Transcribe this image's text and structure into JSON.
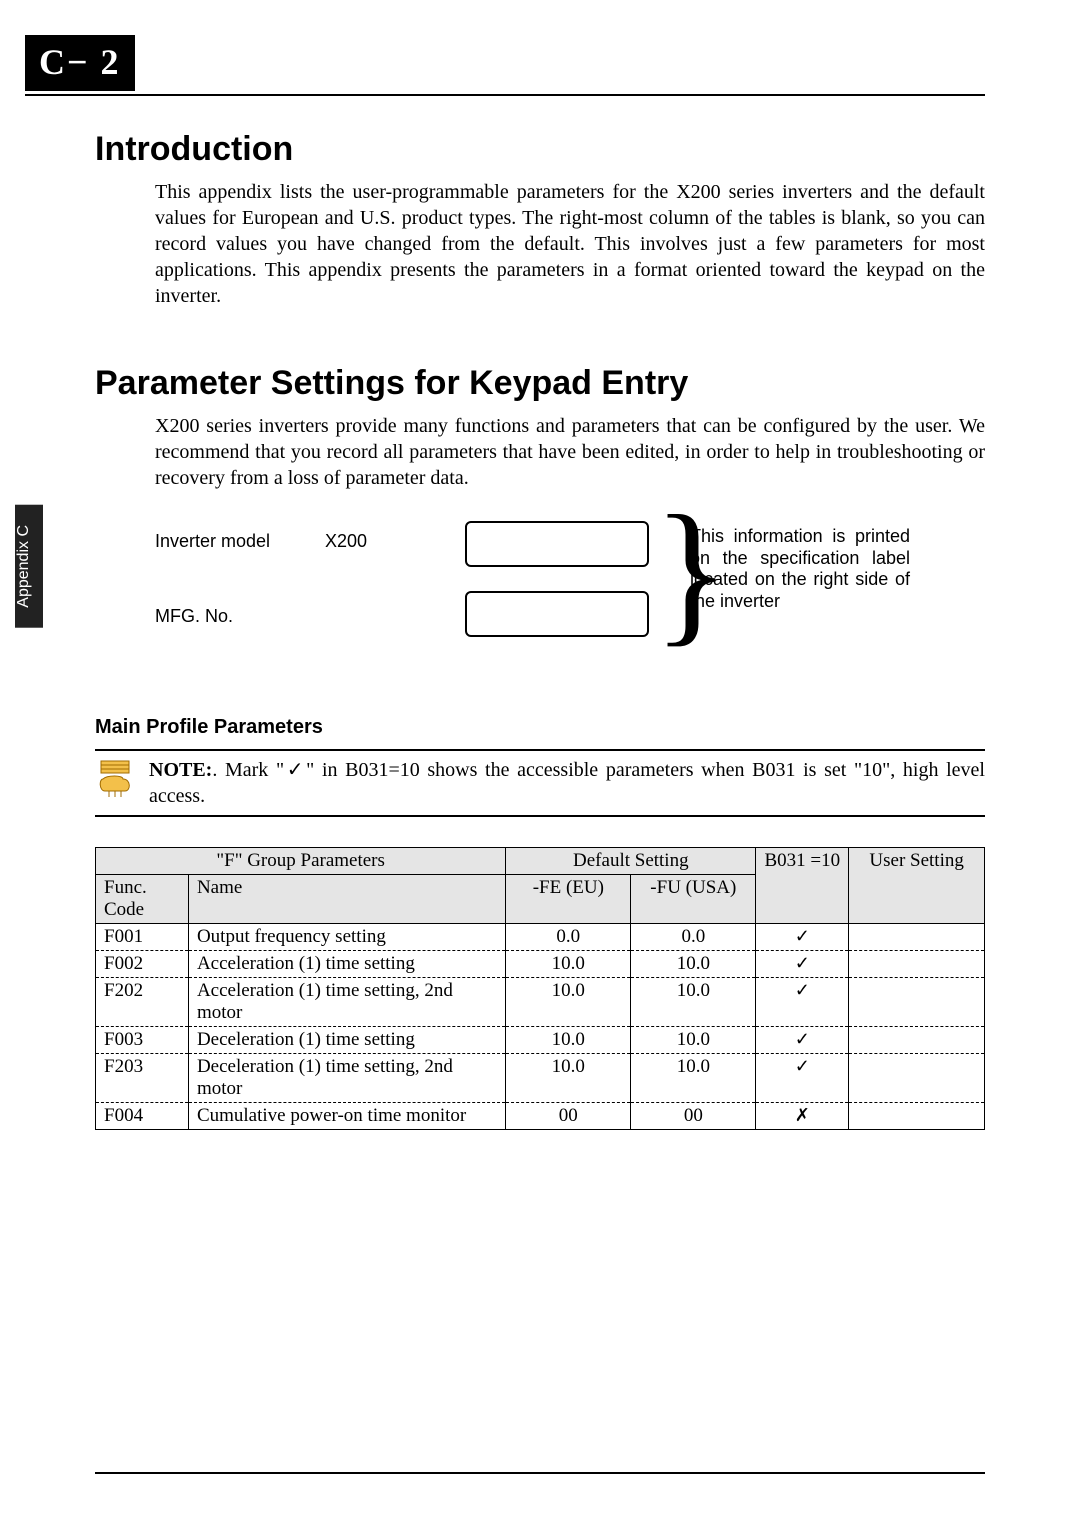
{
  "badge": "C− 2",
  "side_tab": "Appendix C",
  "intro": {
    "heading": "Introduction",
    "text": "This appendix lists the user-programmable parameters for the X200 series inverters and the default values for European and U.S. product types. The right-most column of the tables is blank, so you can record values you have changed from the default. This involves just a few parameters for most applications. This appendix presents the parameters in a format oriented toward the keypad on the inverter."
  },
  "settings": {
    "heading": "Parameter Settings for Keypad Entry",
    "text": "X200 series inverters provide many functions and parameters that can be configured by the user. We recommend that you record all parameters that have been edited, in order to help in troubleshooting or recovery from a loss of parameter data.",
    "label_model": "Inverter model",
    "label_model_value": "X200",
    "label_mfg": "MFG. No.",
    "label_note": "This information is printed on the specification label located on the right side of the inverter"
  },
  "main_profile": {
    "heading": "Main Profile Parameters",
    "note_prefix": "NOTE:",
    "note_body": ". Mark \"✓\" in B031=10 shows the accessible parameters when B031 is set \"10\", high level access."
  },
  "table": {
    "group_header": "\"F\" Group Parameters",
    "default_header": "Default Setting",
    "func_header": "Func. Code",
    "name_header": "Name",
    "fe_header": "-FE (EU)",
    "fu_header": "-FU (USA)",
    "b031_header": "B031 =10",
    "user_header": "User Setting",
    "rows": [
      {
        "code": "F001",
        "name": "Output frequency setting",
        "fe": "0.0",
        "fu": "0.0",
        "b031": "✓"
      },
      {
        "code": "F002",
        "name": "Acceleration (1) time setting",
        "fe": "10.0",
        "fu": "10.0",
        "b031": "✓"
      },
      {
        "code": "F202",
        "name": "Acceleration (1) time setting, 2nd motor",
        "fe": "10.0",
        "fu": "10.0",
        "b031": "✓"
      },
      {
        "code": "F003",
        "name": "Deceleration (1) time setting",
        "fe": "10.0",
        "fu": "10.0",
        "b031": "✓"
      },
      {
        "code": "F203",
        "name": "Deceleration (1) time setting, 2nd motor",
        "fe": "10.0",
        "fu": "10.0",
        "b031": "✓"
      },
      {
        "code": "F004",
        "name": "Cumulative power-on time monitor",
        "fe": "00",
        "fu": "00",
        "b031": "✗"
      }
    ]
  }
}
